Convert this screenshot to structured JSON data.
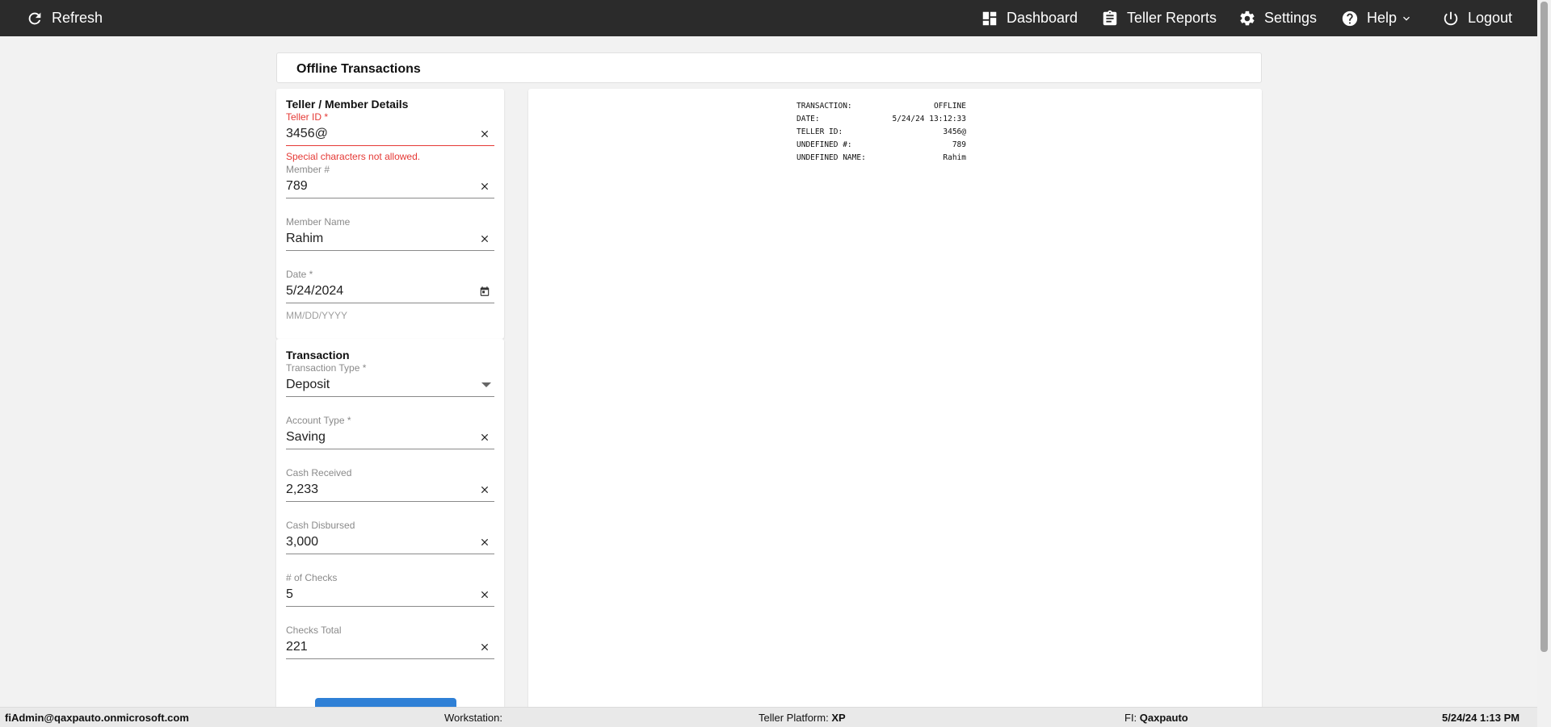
{
  "topbar": {
    "refresh_label": "Refresh",
    "dashboard_label": "Dashboard",
    "teller_reports_label": "Teller Reports",
    "settings_label": "Settings",
    "help_label": "Help",
    "logout_label": "Logout"
  },
  "page": {
    "title": "Offline Transactions"
  },
  "teller_section": {
    "title": "Teller / Member Details",
    "teller_id": {
      "label": "Teller ID *",
      "value": "3456@",
      "error": "Special characters not allowed."
    },
    "member_number": {
      "label": "Member #",
      "value": "789"
    },
    "member_name": {
      "label": "Member Name",
      "value": "Rahim"
    },
    "date": {
      "label": "Date *",
      "value": "5/24/2024",
      "helper": "MM/DD/YYYY"
    }
  },
  "transaction_section": {
    "title": "Transaction",
    "transaction_type": {
      "label": "Transaction Type *",
      "value": "Deposit"
    },
    "account_type": {
      "label": "Account Type *",
      "value": "Saving"
    },
    "cash_received": {
      "label": "Cash Received",
      "value": "2,233"
    },
    "cash_disbursed": {
      "label": "Cash Disbursed",
      "value": "3,000"
    },
    "num_checks": {
      "label": "# of Checks",
      "value": "5"
    },
    "checks_total": {
      "label": "Checks Total",
      "value": "221"
    }
  },
  "receipt": {
    "lines": [
      {
        "key": "TRANSACTION:",
        "value": "OFFLINE"
      },
      {
        "key": "DATE:",
        "value": "5/24/24 13:12:33"
      },
      {
        "key": "TELLER ID:",
        "value": "3456@"
      },
      {
        "key": "UNDEFINED #:",
        "value": "789"
      },
      {
        "key": "UNDEFINED NAME:",
        "value": "Rahim"
      }
    ]
  },
  "statusbar": {
    "user": "fiAdmin@qaxpauto.onmicrosoft.com",
    "workstation_label": "Workstation:",
    "workstation_value": "",
    "platform_label": "Teller Platform:",
    "platform_value": "XP",
    "fi_label": "FI:",
    "fi_value": "Qaxpauto",
    "datetime": "5/24/24 1:13 PM"
  },
  "colors": {
    "topbar_bg": "#2b2b2b",
    "error": "#e53935",
    "primary_button": "#2f80d6",
    "page_bg": "#f2f2f2"
  },
  "icons": [
    "refresh-icon",
    "dashboard-icon",
    "clipboard-icon",
    "gear-icon",
    "help-icon",
    "chevron-down-icon",
    "power-icon",
    "close-icon",
    "calendar-icon",
    "dropdown-arrow-icon"
  ]
}
